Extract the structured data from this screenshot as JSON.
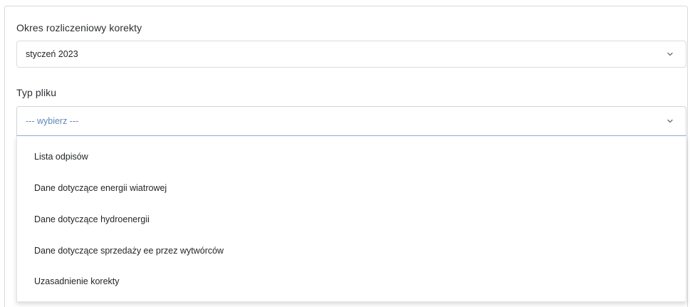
{
  "period": {
    "label": "Okres rozliczeniowy korekty",
    "value": "styczeń 2023"
  },
  "file_type": {
    "label": "Typ pliku",
    "placeholder": "--- wybierz ---",
    "options": [
      "Lista odpisów",
      "Dane dotyczące energii wiatrowej",
      "Dane dotyczące hydroenergii",
      "Dane dotyczące sprzedaży ee przez wytwórców",
      "Uzasadnienie korekty"
    ]
  },
  "icons": {
    "chevron": "chevron-down-icon"
  },
  "colors": {
    "placeholder": "#5f88b8",
    "focus_border": "#8eb4d8"
  }
}
